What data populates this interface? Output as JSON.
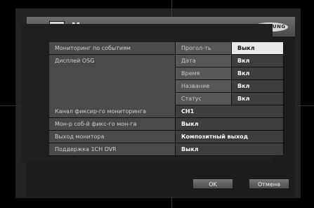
{
  "title": "Мониторинг",
  "brand": "SAMSUNG",
  "rows": {
    "event_monitoring": {
      "label": "Мониторинг по событиям",
      "sub": "Прогол-ть",
      "value": "Выкл"
    },
    "osd_display": {
      "label": "Дисплей OSG",
      "items": [
        {
          "sub": "Дата",
          "value": "Вкл"
        },
        {
          "sub": "Время",
          "value": "Вкл"
        },
        {
          "sub": "Название",
          "value": "Вкл"
        },
        {
          "sub": "Статус",
          "value": "Вкл"
        }
      ]
    },
    "fixed_channel": {
      "label": "Канал фиксир-го мониторинга",
      "value": "CH1"
    },
    "event_fixed": {
      "label": "Мон-р соб-й фикс-го мон-га",
      "value": "Выкл"
    },
    "monitor_output": {
      "label": "Выход монитора",
      "value": "Композитный выход"
    },
    "dvr_support": {
      "label": "Поддержка 1CH DVR",
      "value": "Выкл"
    }
  },
  "buttons": {
    "ok": "OK",
    "cancel": "Отмена"
  }
}
